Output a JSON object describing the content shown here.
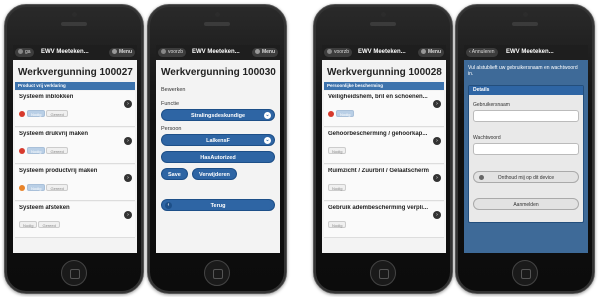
{
  "phone1": {
    "header": {
      "back": "ga",
      "title": "EWV Meeteken...",
      "menu": "Menu"
    },
    "heading": "Werkvergunning 100027",
    "section": "Product vrij verklaring",
    "items": [
      {
        "title": "Systeem inblokken",
        "status_color": "#d73a2d",
        "buttons": [
          "Nodig",
          "Gereed"
        ]
      },
      {
        "title": "Systeem drukvrij maken",
        "status_color": "#d73a2d",
        "buttons": [
          "Nodig",
          "Gereed"
        ]
      },
      {
        "title": "Systeem productvrij maken",
        "status_color": "#e8842a",
        "buttons": [
          "Nodig",
          "Gereed"
        ]
      },
      {
        "title": "Systeem afsteken",
        "status_color": "",
        "buttons": [
          "Nodig",
          "Gereed"
        ]
      }
    ]
  },
  "phone2": {
    "header": {
      "back": "voorzb",
      "title": "EWV Meeteken...",
      "menu": "Menu"
    },
    "heading": "Werkvergunning 100030",
    "edit_label": "Bewerken",
    "function_label": "Functie",
    "function_value": "Stralingsdeskundige",
    "person_label": "Persoon",
    "person_value": "LalkensF",
    "authorized_button": "HasAutorized",
    "save_button": "Save",
    "delete_button": "Verwijderen",
    "back_button": "Terug"
  },
  "phone3": {
    "header": {
      "back": "voorzb",
      "title": "EWV Meeteken...",
      "menu": "Menu"
    },
    "heading": "Werkvergunning 100028",
    "section": "Persoonlijke bescherming",
    "items": [
      {
        "title": "Veiligheidshem, bril en schoenen...",
        "status_color": "#d73a2d",
        "buttons": [
          "Nodig"
        ]
      },
      {
        "title": "Gehoorbescherming / gehoorkap...",
        "status_color": "",
        "buttons": [
          "Nodig"
        ]
      },
      {
        "title": "Ruimzicht / Zuurbril / Gelaatscherm",
        "status_color": "",
        "buttons": [
          "Nodig"
        ]
      },
      {
        "title": "Gebruik adembescherming verpli...",
        "status_color": "",
        "buttons": [
          "Nodig"
        ]
      }
    ]
  },
  "phone4": {
    "header": {
      "back": "Annuleren",
      "title": "EWV Meeteken...",
      "menu": ""
    },
    "hint": "Vul alstublieft uw gebruikersnaam en wachtwoord in.",
    "panel_title": "Details",
    "username_label": "Gebruikersnaam",
    "password_label": "Wachtwoord",
    "remember_button": "Onthoud mij op dit device",
    "login_button": "Aanmelden"
  }
}
